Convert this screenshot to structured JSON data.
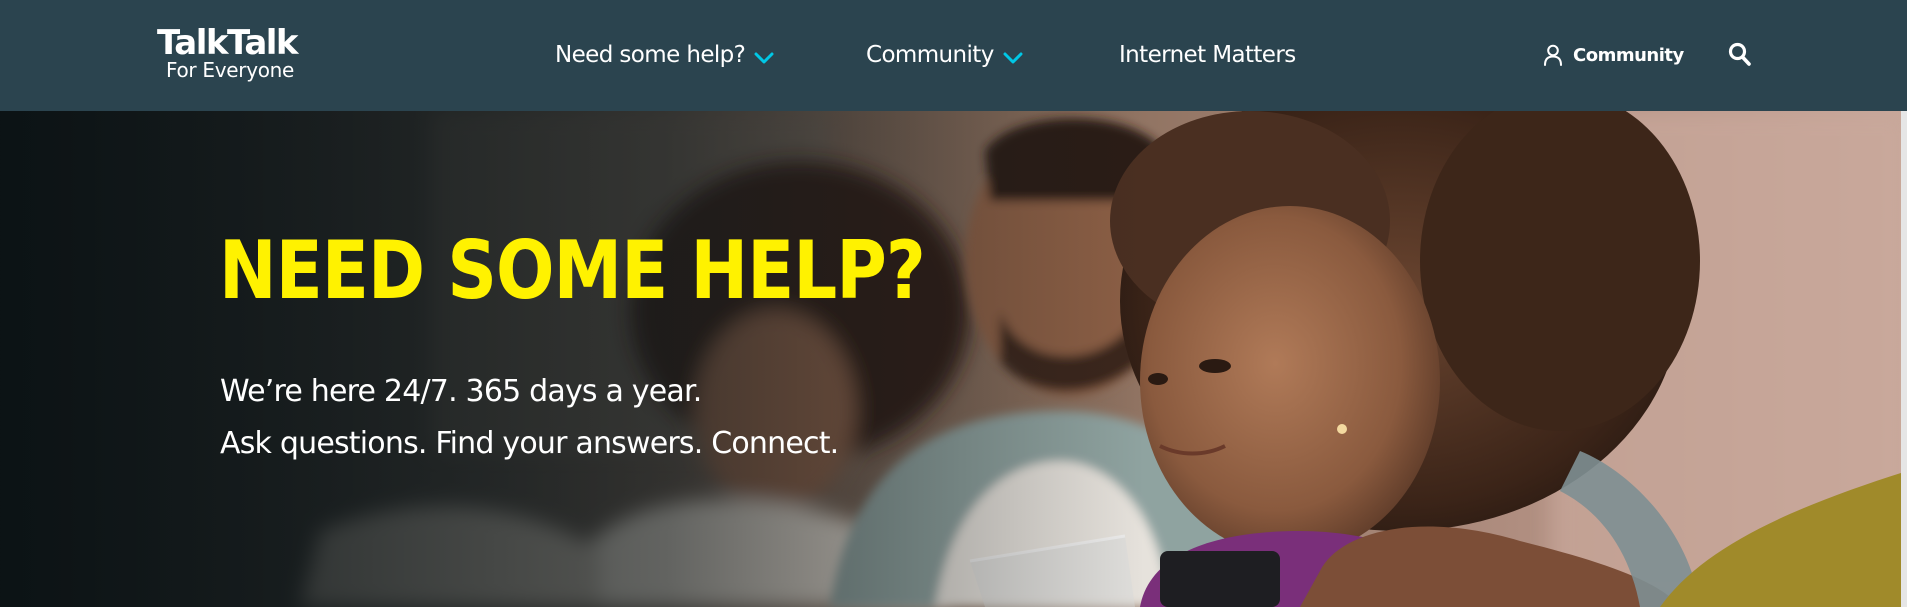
{
  "header": {
    "logo": {
      "brand": "TalkTalk",
      "tagline": "For Everyone",
      "icon": "talktalk-logo"
    },
    "nav": [
      {
        "label": "Need some help?",
        "icon": "chevron-down-icon",
        "has_dropdown": true
      },
      {
        "label": "Community",
        "icon": "chevron-down-icon",
        "has_dropdown": true
      },
      {
        "label": "Internet Matters",
        "has_dropdown": false
      }
    ],
    "sign_in": {
      "label": "Community",
      "icon": "user-icon"
    },
    "search": {
      "icon": "search-icon"
    },
    "background_color": "#2b444f",
    "accent_color": "#00c8e6"
  },
  "hero": {
    "title": "NEED SOME HELP?",
    "lines": [
      "We’re here 24/7. 365 days a year.",
      "Ask questions. Find your answers. Connect."
    ],
    "title_color": "#fff200",
    "image": "family-watching-tv-photo"
  }
}
